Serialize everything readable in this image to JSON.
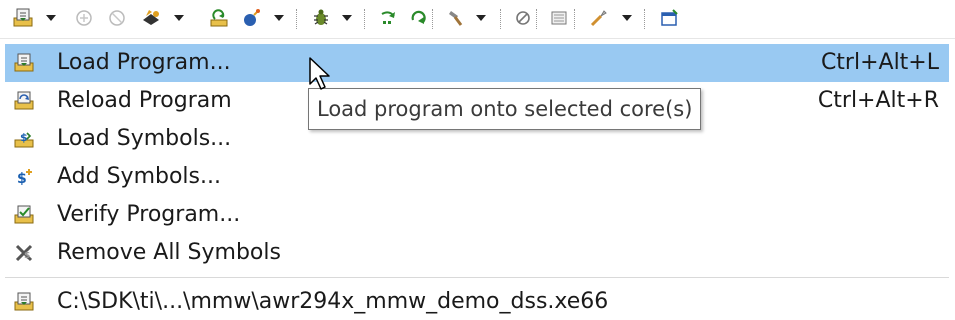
{
  "toolbar": {
    "icons": [
      "load-program-icon",
      "reload-program-icon",
      "load-symbols-icon",
      "restart-icon",
      "step-icon",
      "debug-icon",
      "step-over-icon",
      "step-return-icon",
      "hammer-icon",
      "expressions-icon",
      "memory-icon",
      "tools-icon",
      "open-view-icon"
    ]
  },
  "menu": {
    "items": [
      {
        "label": "Load Program...",
        "shortcut": "Ctrl+Alt+L",
        "icon": "load-program-icon",
        "highlighted": true
      },
      {
        "label": "Reload Program",
        "shortcut": "Ctrl+Alt+R",
        "icon": "reload-program-icon"
      },
      {
        "label": "Load Symbols...",
        "shortcut": "",
        "icon": "load-symbols-icon"
      },
      {
        "label": "Add Symbols...",
        "shortcut": "",
        "icon": "add-symbols-icon"
      },
      {
        "label": "Verify Program...",
        "shortcut": "",
        "icon": "verify-program-icon"
      },
      {
        "label": "Remove All Symbols",
        "shortcut": "",
        "icon": "remove-symbols-icon"
      }
    ],
    "recent": [
      {
        "label": "C:\\SDK\\ti\\...\\mmw\\awr294x_mmw_demo_dss.xe66",
        "icon": "load-program-icon"
      }
    ]
  },
  "tooltip": {
    "text": "Load program onto selected core(s)"
  },
  "colors": {
    "highlight": "#99c9f2",
    "tooltip_border": "#767676"
  }
}
